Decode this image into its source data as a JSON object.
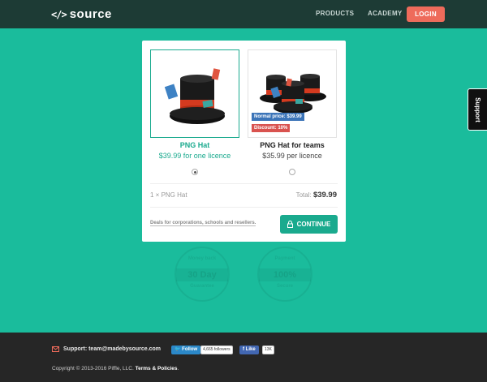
{
  "header": {
    "logo_mark": "</>",
    "logo_text": "source",
    "nav": {
      "products": "PRODUCTS",
      "academy": "ACADEMY",
      "login": "LOGIN"
    }
  },
  "support_tab": {
    "label": "Support"
  },
  "options": [
    {
      "title": "PNG Hat",
      "price": "$39.99 for one licence",
      "selected": true
    },
    {
      "title": "PNG Hat for teams",
      "price": "$35.99 per licence",
      "selected": false,
      "badges": {
        "normal": "Normal price: $39.99",
        "discount": "Discount: 10%"
      }
    }
  ],
  "summary": {
    "item": "1 × PNG Hat",
    "total_label": "Total:",
    "total_value": "$39.99"
  },
  "deals_link": "Deals for corporations, schools and resellers.",
  "continue_label": "CONTINUE",
  "stamps": [
    {
      "top": "Money back",
      "band": "30 Day",
      "bottom": "Guarantee"
    },
    {
      "top": "Payment",
      "band": "100%",
      "bottom": "Secure"
    }
  ],
  "footer": {
    "support": "Support: team@madebysource.com",
    "twitter_label": "Follow",
    "twitter_count": "4,665 followers",
    "facebook_label": "Like",
    "facebook_count": "13K",
    "copyright": "Copyright © 2013-2016 Piffle, LLC.",
    "terms": "Terms & Policies",
    "terms_suffix": "."
  },
  "colors": {
    "teal": "#1abc9c",
    "header": "#1d3b35",
    "accent": "#1aaa8e",
    "login": "#ee6b5b",
    "footer": "#262626"
  }
}
